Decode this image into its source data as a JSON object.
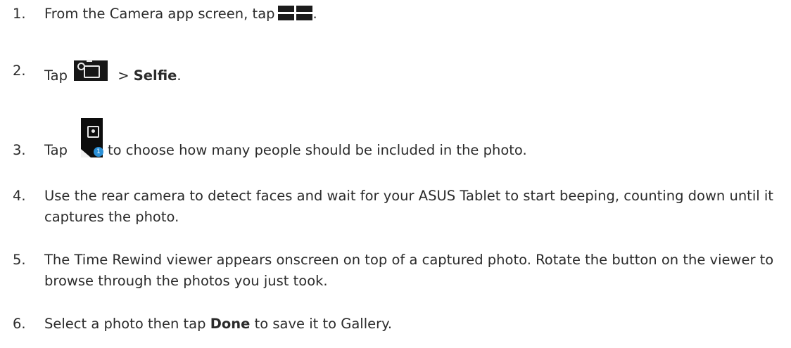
{
  "steps": [
    {
      "num": "1.",
      "text_before": "From the Camera app screen, tap",
      "icon": "grid-mode-icon",
      "text_after": "."
    },
    {
      "num": "2.",
      "text_before": "Tap",
      "icon": "camera-icon",
      "text_mid": " > ",
      "bold": "Selfie",
      "text_after": "."
    },
    {
      "num": "3.",
      "text_before": "Tap",
      "icon": "selfie-people-count-icon",
      "icon_badge": "1",
      "text_after": "to choose how many people should be included in the photo."
    },
    {
      "num": "4.",
      "text": "Use the rear camera to detect faces and wait for your ASUS Tablet to start beeping, counting down until it captures the photo."
    },
    {
      "num": "5.",
      "text": "The Time Rewind viewer appears onscreen on top of a captured photo. Rotate the button on the viewer to browse through the photos you just took."
    },
    {
      "num": "6.",
      "text_before": "Select a photo then tap ",
      "bold": "Done",
      "text_after": " to save it to Gallery."
    }
  ]
}
